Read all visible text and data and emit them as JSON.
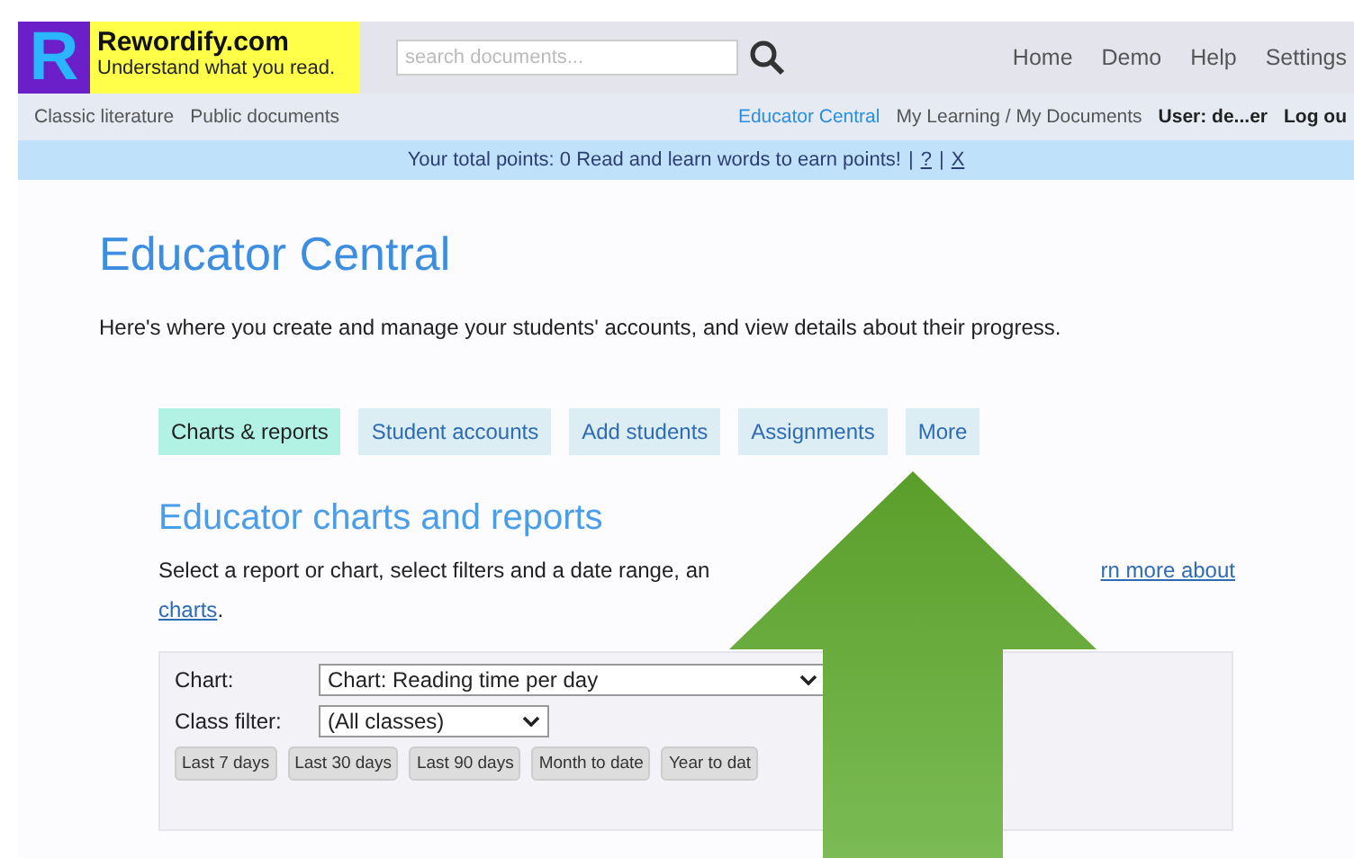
{
  "header": {
    "logo_letter": "R",
    "site_name": "Rewordify.com",
    "tagline": "Understand what you read.",
    "search": {
      "placeholder": "search documents..."
    },
    "nav": [
      "Home",
      "Demo",
      "Help",
      "Settings"
    ]
  },
  "subnav": {
    "left": [
      "Classic literature",
      "Public documents"
    ],
    "right": [
      {
        "label": "Educator Central",
        "selected": true
      },
      {
        "label": "My Learning / My Documents",
        "selected": false
      }
    ],
    "user": "User: de...er",
    "logout": "Log ou"
  },
  "points_bar": {
    "text": "Your total points: 0  Read and learn words to earn points!",
    "sep1": "|",
    "help": "?",
    "sep2": "|",
    "close": "X"
  },
  "page": {
    "title": "Educator Central",
    "description": "Here's where you create and manage your students' accounts, and view details about their progress.",
    "tabs": [
      {
        "label": "Charts & reports",
        "selected": true
      },
      {
        "label": "Student accounts",
        "selected": false
      },
      {
        "label": "Add students",
        "selected": false
      },
      {
        "label": "Assignments",
        "selected": false
      },
      {
        "label": "More",
        "selected": false
      }
    ],
    "section_title": "Educator charts and reports",
    "intro_text": "Select a report or chart, select filters and a date range, an",
    "intro_link_1": "rn more about",
    "intro_link_2": "charts",
    "intro_end": ".",
    "form": {
      "chart_label": "Chart:",
      "chart_value": "Chart: Reading time per day",
      "class_label": "Class filter:",
      "class_value": "(All classes)",
      "ranges": [
        "Last 7 days",
        "Last 30 days",
        "Last 90 days",
        "Month to date",
        "Year to dat"
      ]
    }
  }
}
